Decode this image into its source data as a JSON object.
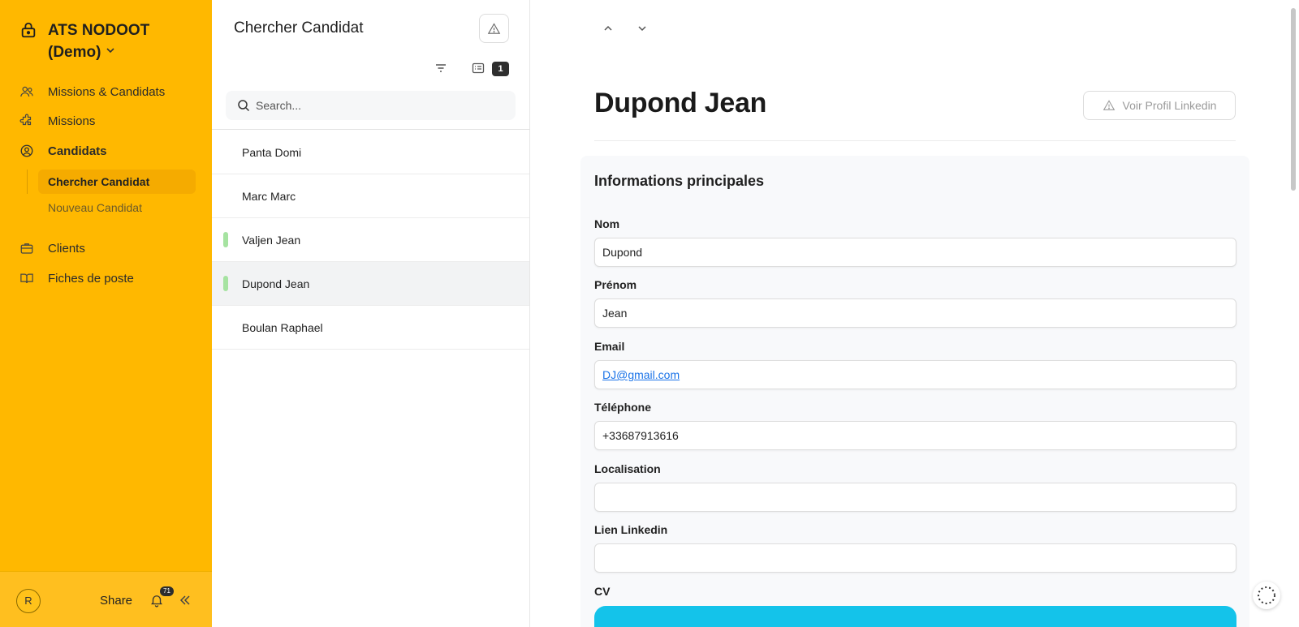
{
  "app": {
    "title_line1": "ATS NODOOT",
    "title_line2": "(Demo)"
  },
  "sidebar": {
    "items": [
      {
        "label": "Missions & Candidats",
        "icon": "users-icon"
      },
      {
        "label": "Missions",
        "icon": "puzzle-icon"
      },
      {
        "label": "Candidats",
        "icon": "user-circle-icon"
      },
      {
        "label": "Clients",
        "icon": "briefcase-icon"
      },
      {
        "label": "Fiches de poste",
        "icon": "book-open-icon"
      }
    ],
    "subitems": [
      {
        "label": "Chercher Candidat",
        "active": true
      },
      {
        "label": "Nouveau Candidat",
        "active": false
      }
    ],
    "footer": {
      "avatar_initial": "R",
      "share_label": "Share",
      "notification_count": "71"
    }
  },
  "list": {
    "title": "Chercher Candidat",
    "count": "1",
    "search_placeholder": "Search...",
    "rows": [
      {
        "name": "Panta Domi",
        "tagged": false,
        "selected": false
      },
      {
        "name": "Marc Marc",
        "tagged": false,
        "selected": false
      },
      {
        "name": "Valjen Jean",
        "tagged": true,
        "selected": false
      },
      {
        "name": "Dupond Jean",
        "tagged": true,
        "selected": true
      },
      {
        "name": "Boulan Raphael",
        "tagged": false,
        "selected": false
      }
    ]
  },
  "detail": {
    "name": "Dupond Jean",
    "linkedin_button": "Voir Profil Linkedin",
    "section_title": "Informations principales",
    "fields": {
      "nom": {
        "label": "Nom",
        "value": "Dupond"
      },
      "prenom": {
        "label": "Prénom",
        "value": "Jean"
      },
      "email": {
        "label": "Email",
        "value": "DJ@gmail.com"
      },
      "telephone": {
        "label": "Téléphone",
        "value": "+33687913616"
      },
      "localisation": {
        "label": "Localisation",
        "value": ""
      },
      "linkedin": {
        "label": "Lien Linkedin",
        "value": ""
      },
      "cv": {
        "label": "CV"
      }
    }
  },
  "colors": {
    "sidebar": "#ffb800",
    "tag": "#a6e3a1",
    "cv_bar": "#14c3ea"
  }
}
